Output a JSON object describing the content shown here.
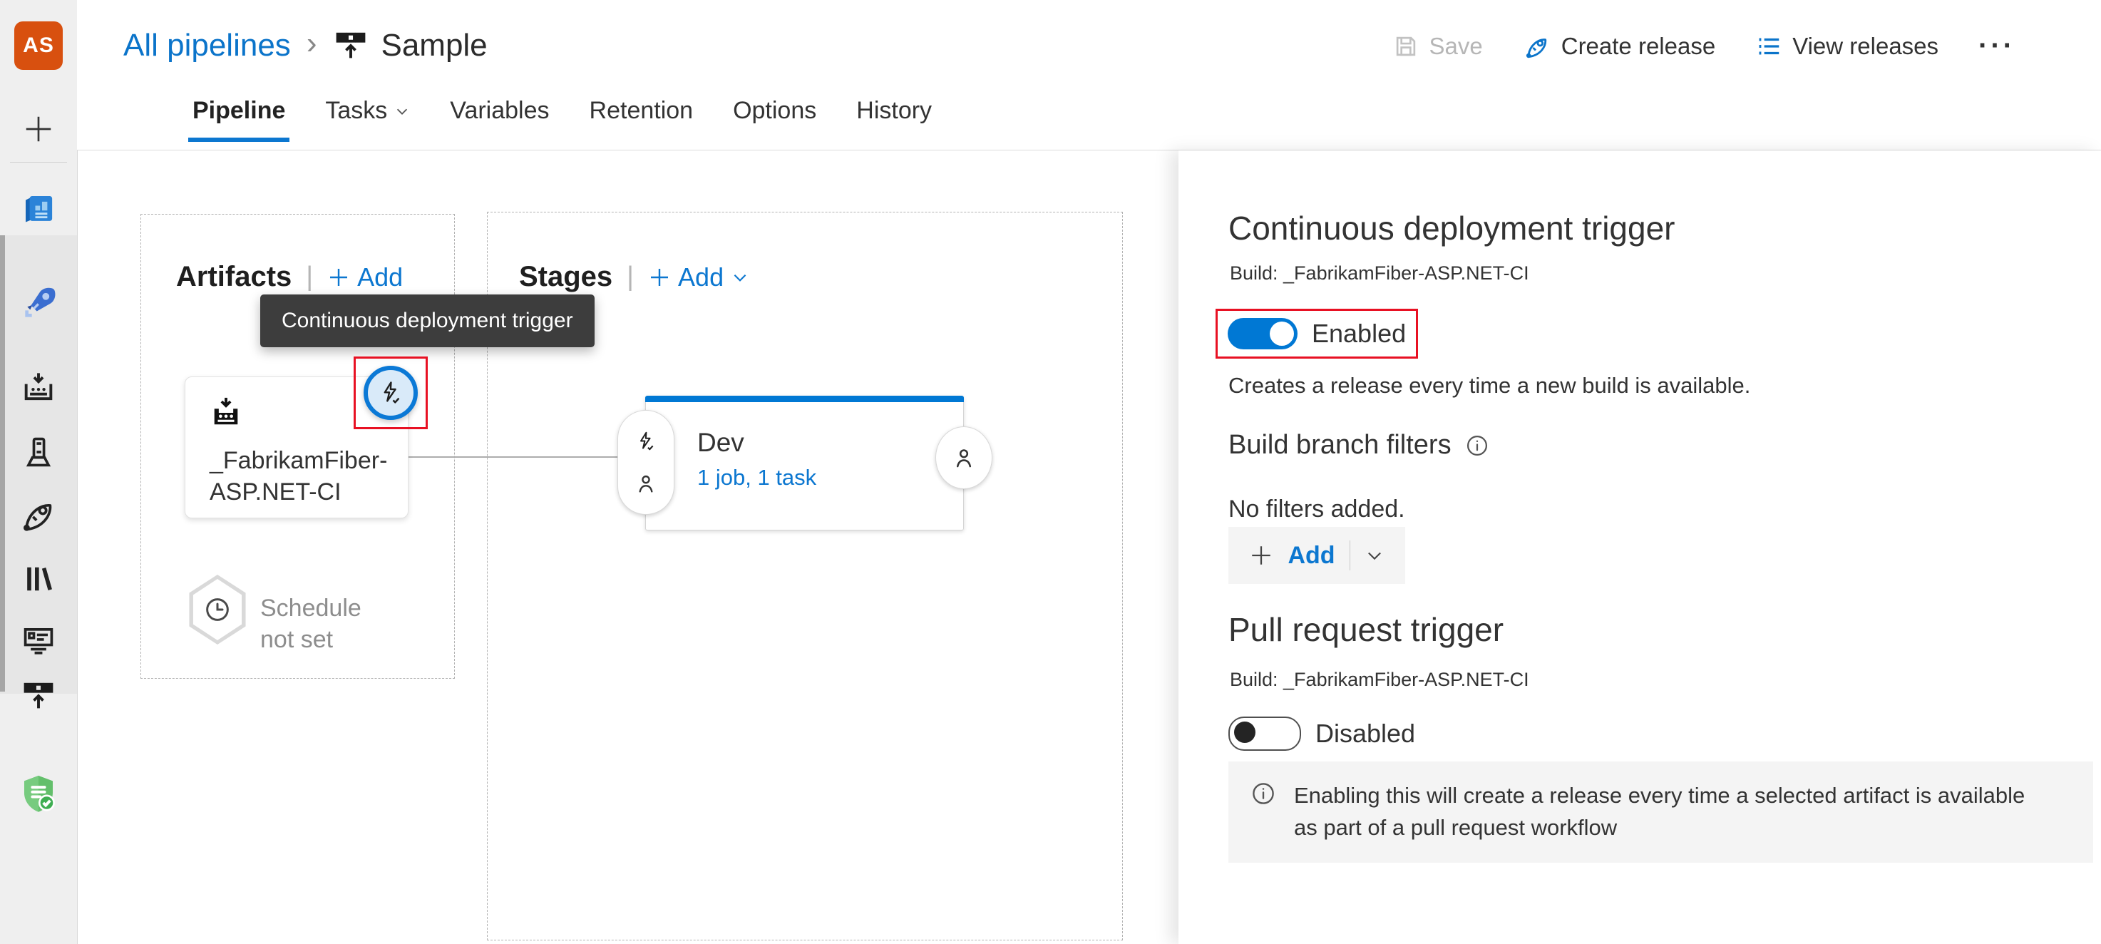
{
  "colors": {
    "accent_blue": "#0c77d0",
    "toggle_blue": "#0078d4",
    "highlight_red": "#e81123",
    "tooltip_bg": "#3d3d3d",
    "panel_section_gray": "#f4f4f4",
    "avatar_orange": "#d8500f"
  },
  "sidebar": {
    "avatar": "AS",
    "items": [
      {
        "name": "add"
      },
      {
        "name": "overview"
      },
      {
        "name": "pipelines"
      },
      {
        "name": "builds"
      },
      {
        "name": "deployment-pools"
      },
      {
        "name": "releases"
      },
      {
        "name": "library"
      },
      {
        "name": "task-groups"
      },
      {
        "name": "deployment-groups"
      },
      {
        "name": "compliance-shield"
      }
    ]
  },
  "breadcrumb": {
    "parent": "All pipelines",
    "separator": "›",
    "current": "Sample"
  },
  "commands": {
    "save": "Save",
    "create_release": "Create release",
    "view_releases": "View releases",
    "more": "···"
  },
  "tabs": {
    "items": [
      {
        "label": "Pipeline",
        "active": true
      },
      {
        "label": "Tasks",
        "has_menu": true
      },
      {
        "label": "Variables"
      },
      {
        "label": "Retention"
      },
      {
        "label": "Options"
      },
      {
        "label": "History"
      }
    ]
  },
  "artifacts": {
    "title": "Artifacts",
    "divider": "|",
    "add_label": "Add",
    "tooltip": "Continuous deployment trigger",
    "card": {
      "name": "_FabrikamFiber-ASP.NET-CI"
    },
    "schedule": {
      "label": "Schedule not set"
    }
  },
  "stages": {
    "title": "Stages",
    "divider": "|",
    "add_label": "Add",
    "dev": {
      "name": "Dev",
      "meta": "1 job, 1 task"
    }
  },
  "panel": {
    "cd_trigger": {
      "title": "Continuous deployment trigger",
      "build": "Build: _FabrikamFiber-ASP.NET-CI",
      "toggle_state": "on",
      "toggle_label": "Enabled",
      "description": "Creates a release every time a new build is available."
    },
    "branch_filters": {
      "title": "Build branch filters",
      "empty": "No filters added.",
      "add_label": "Add"
    },
    "pr_trigger": {
      "title": "Pull request trigger",
      "build": "Build: _FabrikamFiber-ASP.NET-CI",
      "toggle_state": "off",
      "toggle_label": "Disabled",
      "info": "Enabling this will create a release every time a selected artifact is available as part of a pull request workflow"
    }
  }
}
